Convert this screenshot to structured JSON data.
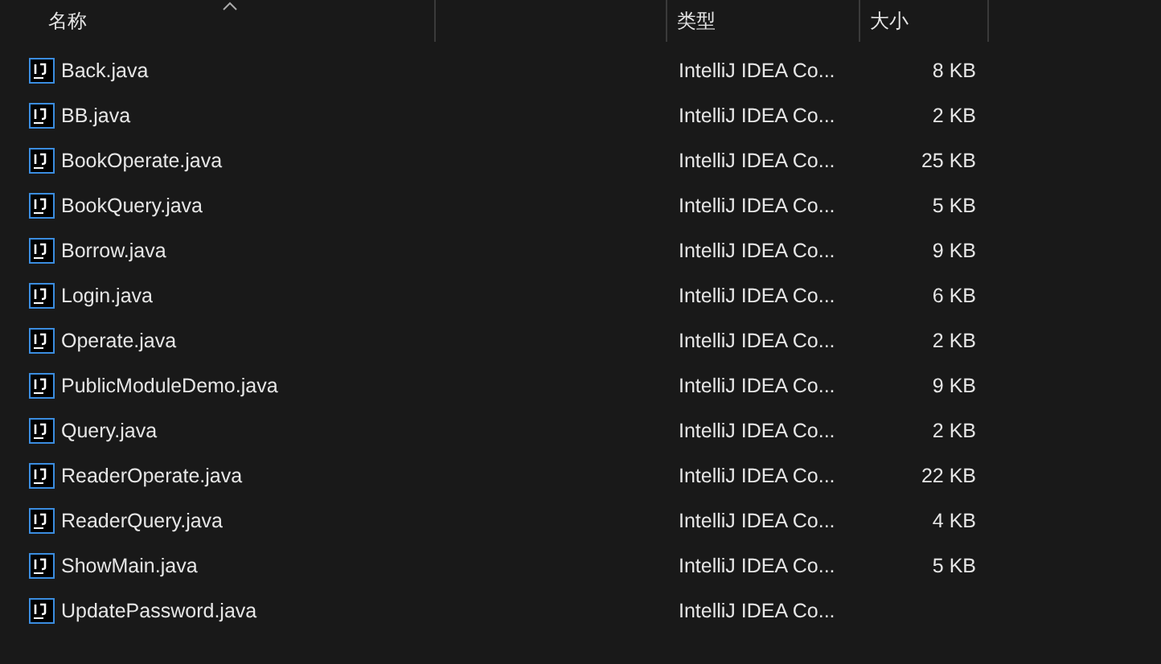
{
  "columns": [
    {
      "label": "名称",
      "sorted": true
    },
    {
      "label": "类型",
      "sorted": false
    },
    {
      "label": "大小",
      "sorted": false
    }
  ],
  "files": [
    {
      "name": "Back.java",
      "type": "IntelliJ IDEA Co...",
      "size": "8 KB"
    },
    {
      "name": "BB.java",
      "type": "IntelliJ IDEA Co...",
      "size": "2 KB"
    },
    {
      "name": "BookOperate.java",
      "type": "IntelliJ IDEA Co...",
      "size": "25 KB"
    },
    {
      "name": "BookQuery.java",
      "type": "IntelliJ IDEA Co...",
      "size": "5 KB"
    },
    {
      "name": "Borrow.java",
      "type": "IntelliJ IDEA Co...",
      "size": "9 KB"
    },
    {
      "name": "Login.java",
      "type": "IntelliJ IDEA Co...",
      "size": "6 KB"
    },
    {
      "name": "Operate.java",
      "type": "IntelliJ IDEA Co...",
      "size": "2 KB"
    },
    {
      "name": "PublicModuleDemo.java",
      "type": "IntelliJ IDEA Co...",
      "size": "9 KB"
    },
    {
      "name": "Query.java",
      "type": "IntelliJ IDEA Co...",
      "size": "2 KB"
    },
    {
      "name": "ReaderOperate.java",
      "type": "IntelliJ IDEA Co...",
      "size": "22 KB"
    },
    {
      "name": "ReaderQuery.java",
      "type": "IntelliJ IDEA Co...",
      "size": "4 KB"
    },
    {
      "name": "ShowMain.java",
      "type": "IntelliJ IDEA Co...",
      "size": "5 KB"
    },
    {
      "name": "UpdatePassword.java",
      "type": "IntelliJ IDEA Co..."
    }
  ]
}
